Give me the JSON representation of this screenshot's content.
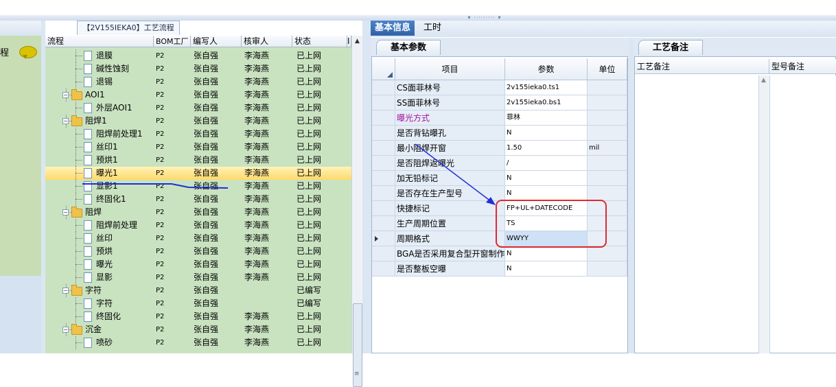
{
  "grid": {
    "title": "【2V155IEKA0】工艺流程",
    "headers": [
      "流程",
      "BOM工厂",
      "编写人",
      "核审人",
      "状态",
      "I"
    ],
    "rows": [
      {
        "name": "退膜",
        "level": 2,
        "type": "doc",
        "bom": "P2",
        "writer": "张自强",
        "reviewer": "李海燕",
        "status": "已上网"
      },
      {
        "name": "碱性蚀刻",
        "level": 2,
        "type": "doc",
        "bom": "P2",
        "writer": "张自强",
        "reviewer": "李海燕",
        "status": "已上网"
      },
      {
        "name": "退锡",
        "level": 2,
        "type": "doc",
        "bom": "P2",
        "writer": "张自强",
        "reviewer": "李海燕",
        "status": "已上网"
      },
      {
        "name": "AOI1",
        "level": 1,
        "type": "folder",
        "bom": "P2",
        "writer": "张自强",
        "reviewer": "李海燕",
        "status": "已上网"
      },
      {
        "name": "外层AOI1",
        "level": 2,
        "type": "doc",
        "bom": "P2",
        "writer": "张自强",
        "reviewer": "李海燕",
        "status": "已上网"
      },
      {
        "name": "阻焊1",
        "level": 1,
        "type": "folder",
        "bom": "P2",
        "writer": "张自强",
        "reviewer": "李海燕",
        "status": "已上网"
      },
      {
        "name": "阻焊前处理1",
        "level": 2,
        "type": "doc",
        "bom": "P2",
        "writer": "张自强",
        "reviewer": "李海燕",
        "status": "已上网"
      },
      {
        "name": "丝印1",
        "level": 2,
        "type": "doc",
        "bom": "P2",
        "writer": "张自强",
        "reviewer": "李海燕",
        "status": "已上网"
      },
      {
        "name": "预烘1",
        "level": 2,
        "type": "doc",
        "bom": "P2",
        "writer": "张自强",
        "reviewer": "李海燕",
        "status": "已上网"
      },
      {
        "name": "曝光1",
        "level": 2,
        "type": "doc",
        "bom": "P2",
        "writer": "张自强",
        "reviewer": "李海燕",
        "status": "已上网",
        "selected": true
      },
      {
        "name": "显影1",
        "level": 2,
        "type": "doc",
        "bom": "P2",
        "writer": "张自强",
        "reviewer": "李海燕",
        "status": "已上网"
      },
      {
        "name": "终固化1",
        "level": 2,
        "type": "doc",
        "bom": "P2",
        "writer": "张自强",
        "reviewer": "李海燕",
        "status": "已上网"
      },
      {
        "name": "阻焊",
        "level": 1,
        "type": "folder",
        "bom": "P2",
        "writer": "张自强",
        "reviewer": "李海燕",
        "status": "已上网"
      },
      {
        "name": "阻焊前处理",
        "level": 2,
        "type": "doc",
        "bom": "P2",
        "writer": "张自强",
        "reviewer": "李海燕",
        "status": "已上网"
      },
      {
        "name": "丝印",
        "level": 2,
        "type": "doc",
        "bom": "P2",
        "writer": "张自强",
        "reviewer": "李海燕",
        "status": "已上网"
      },
      {
        "name": "预烘",
        "level": 2,
        "type": "doc",
        "bom": "P2",
        "writer": "张自强",
        "reviewer": "李海燕",
        "status": "已上网"
      },
      {
        "name": "曝光",
        "level": 2,
        "type": "doc",
        "bom": "P2",
        "writer": "张自强",
        "reviewer": "李海燕",
        "status": "已上网"
      },
      {
        "name": "显影",
        "level": 2,
        "type": "doc",
        "bom": "P2",
        "writer": "张自强",
        "reviewer": "李海燕",
        "status": "已上网"
      },
      {
        "name": "字符",
        "level": 1,
        "type": "folder",
        "bom": "P2",
        "writer": "张自强",
        "reviewer": "",
        "status": "已编写"
      },
      {
        "name": "字符",
        "level": 2,
        "type": "doc",
        "bom": "P2",
        "writer": "张自强",
        "reviewer": "",
        "status": "已编写"
      },
      {
        "name": "终固化",
        "level": 2,
        "type": "doc",
        "bom": "P2",
        "writer": "张自强",
        "reviewer": "李海燕",
        "status": "已上网"
      },
      {
        "name": "沉金",
        "level": 1,
        "type": "folder",
        "bom": "P2",
        "writer": "张自强",
        "reviewer": "李海燕",
        "status": "已上网"
      },
      {
        "name": "喷砂",
        "level": 2,
        "type": "doc",
        "bom": "P2",
        "writer": "张自强",
        "reviewer": "李海燕",
        "status": "已上网"
      }
    ]
  },
  "left": {
    "label": "程"
  },
  "tabs": [
    "基本信息",
    "工时"
  ],
  "params": {
    "tab_label": "基本参数",
    "headers": [
      "项目",
      "参数",
      "单位"
    ],
    "rows": [
      {
        "item": "CS面菲林号",
        "value": "2v155ieka0.ts1",
        "unit": ""
      },
      {
        "item": "SS面菲林号",
        "value": "2v155ieka0.bs1",
        "unit": ""
      },
      {
        "item": "曝光方式",
        "value": "菲林",
        "unit": "",
        "magenta": true
      },
      {
        "item": "是否背钻曝孔",
        "value": "N",
        "unit": ""
      },
      {
        "item": "最小阻焊开窗",
        "value": "1.50",
        "unit": "mil"
      },
      {
        "item": "是否阻焊返曝光",
        "value": "/",
        "unit": ""
      },
      {
        "item": "加无铅标记",
        "value": "N",
        "unit": ""
      },
      {
        "item": "是否存在生产型号",
        "value": "N",
        "unit": ""
      },
      {
        "item": "快捷标记",
        "value": "FP+UL+DATECODE",
        "unit": ""
      },
      {
        "item": "生产周期位置",
        "value": "TS",
        "unit": ""
      },
      {
        "item": "周期格式",
        "value": "WWYY",
        "unit": "",
        "current": true
      },
      {
        "item": "BGA是否采用复合型开窗制作",
        "value": "N",
        "unit": ""
      },
      {
        "item": "是否整板空曝",
        "value": "N",
        "unit": ""
      }
    ]
  },
  "notes": {
    "tab_label": "工艺备注",
    "headers": [
      "工艺备注",
      "型号备注"
    ]
  },
  "colors": {
    "annotation_blue": "#1f2fd6",
    "annotation_red": "#e0292f",
    "selected_row": "#ffd96b",
    "tree_background": "#c9e3c1"
  }
}
